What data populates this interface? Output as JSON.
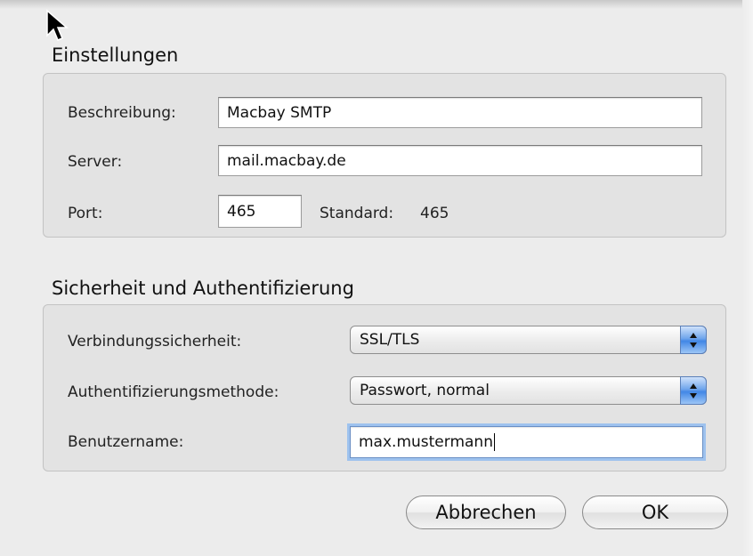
{
  "settings": {
    "title": "Einstellungen",
    "description_label": "Beschreibung:",
    "description_value": "Macbay SMTP",
    "server_label": "Server:",
    "server_value": "mail.macbay.de",
    "port_label": "Port:",
    "port_value": "465",
    "default_label": "Standard:",
    "default_value": "465"
  },
  "security": {
    "title": "Sicherheit und Authentifizierung",
    "connection_label": "Verbindungssicherheit:",
    "connection_value": "SSL/TLS",
    "auth_label": "Authentifizierungsmethode:",
    "auth_value": "Passwort, normal",
    "username_label": "Benutzername:",
    "username_value": "max.mustermann"
  },
  "buttons": {
    "cancel_label": "Abbrechen",
    "ok_label": "OK"
  },
  "icons": {
    "cursor": "arrow-cursor-icon",
    "popup_stepper": "up-down-arrows-icon"
  },
  "colors": {
    "focus_ring": "#9ec2ee",
    "stepper_blue": "#4287e6",
    "window_bg": "#ececec"
  }
}
